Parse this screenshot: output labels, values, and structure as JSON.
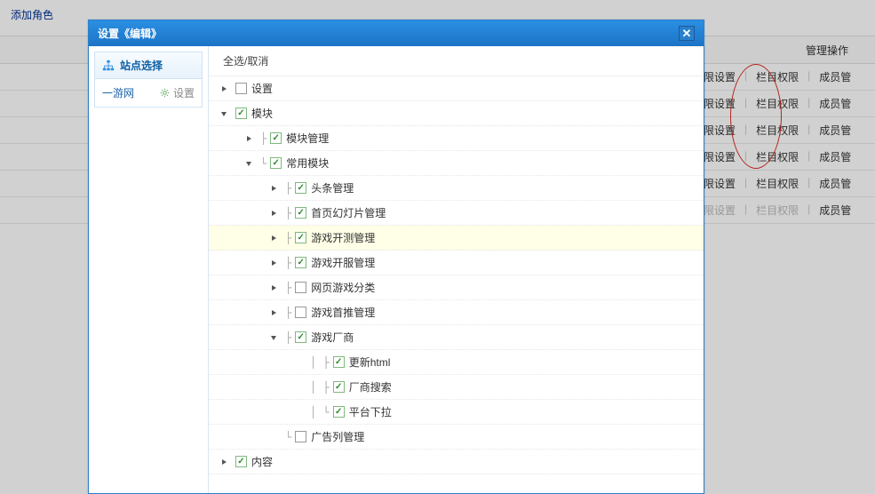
{
  "page": {
    "add_role": "添加角色",
    "mgmt_header": "管理操作",
    "ops": {
      "perm": "权限设置",
      "col": "栏目权限",
      "mem": "成员管"
    }
  },
  "dialog": {
    "title": "设置《编辑》",
    "sidebar": {
      "header": "站点选择",
      "site_name": "一游网",
      "site_action": "设置"
    },
    "select_all": "全选/取消"
  },
  "tree": [
    {
      "depth": 0,
      "caret": "right",
      "checked": false,
      "branch": "",
      "label": "设置"
    },
    {
      "depth": 0,
      "caret": "down",
      "checked": true,
      "branch": "",
      "label": "模块"
    },
    {
      "depth": 1,
      "caret": "right",
      "checked": true,
      "branch": "├",
      "label": "模块管理"
    },
    {
      "depth": 1,
      "caret": "down",
      "checked": true,
      "branch": "└",
      "label": "常用模块"
    },
    {
      "depth": 2,
      "caret": "right",
      "checked": true,
      "branch": "├",
      "label": "头条管理"
    },
    {
      "depth": 2,
      "caret": "right",
      "checked": true,
      "branch": "├",
      "label": "首页幻灯片管理"
    },
    {
      "depth": 2,
      "caret": "right",
      "checked": true,
      "branch": "├",
      "label": "游戏开测管理",
      "hover": true
    },
    {
      "depth": 2,
      "caret": "right",
      "checked": true,
      "branch": "├",
      "label": "游戏开服管理"
    },
    {
      "depth": 2,
      "caret": "right",
      "checked": false,
      "branch": "├",
      "label": "网页游戏分类"
    },
    {
      "depth": 2,
      "caret": "right",
      "checked": false,
      "branch": "├",
      "label": "游戏首推管理"
    },
    {
      "depth": 2,
      "caret": "down",
      "checked": true,
      "branch": "├",
      "label": "游戏厂商"
    },
    {
      "depth": 3,
      "caret": "none",
      "checked": true,
      "branch": "│  ├",
      "label": "更新html"
    },
    {
      "depth": 3,
      "caret": "none",
      "checked": true,
      "branch": "│  ├",
      "label": "厂商搜索"
    },
    {
      "depth": 3,
      "caret": "none",
      "checked": true,
      "branch": "│  └",
      "label": "平台下拉"
    },
    {
      "depth": 2,
      "caret": "none",
      "checked": false,
      "branch": "└",
      "label": "广告列管理"
    },
    {
      "depth": 0,
      "caret": "right",
      "checked": true,
      "branch": "",
      "label": "内容"
    }
  ],
  "bg_rows": [
    {
      "disabled": false
    },
    {
      "disabled": false
    },
    {
      "disabled": false
    },
    {
      "disabled": false
    },
    {
      "disabled": false
    },
    {
      "disabled": true
    }
  ]
}
